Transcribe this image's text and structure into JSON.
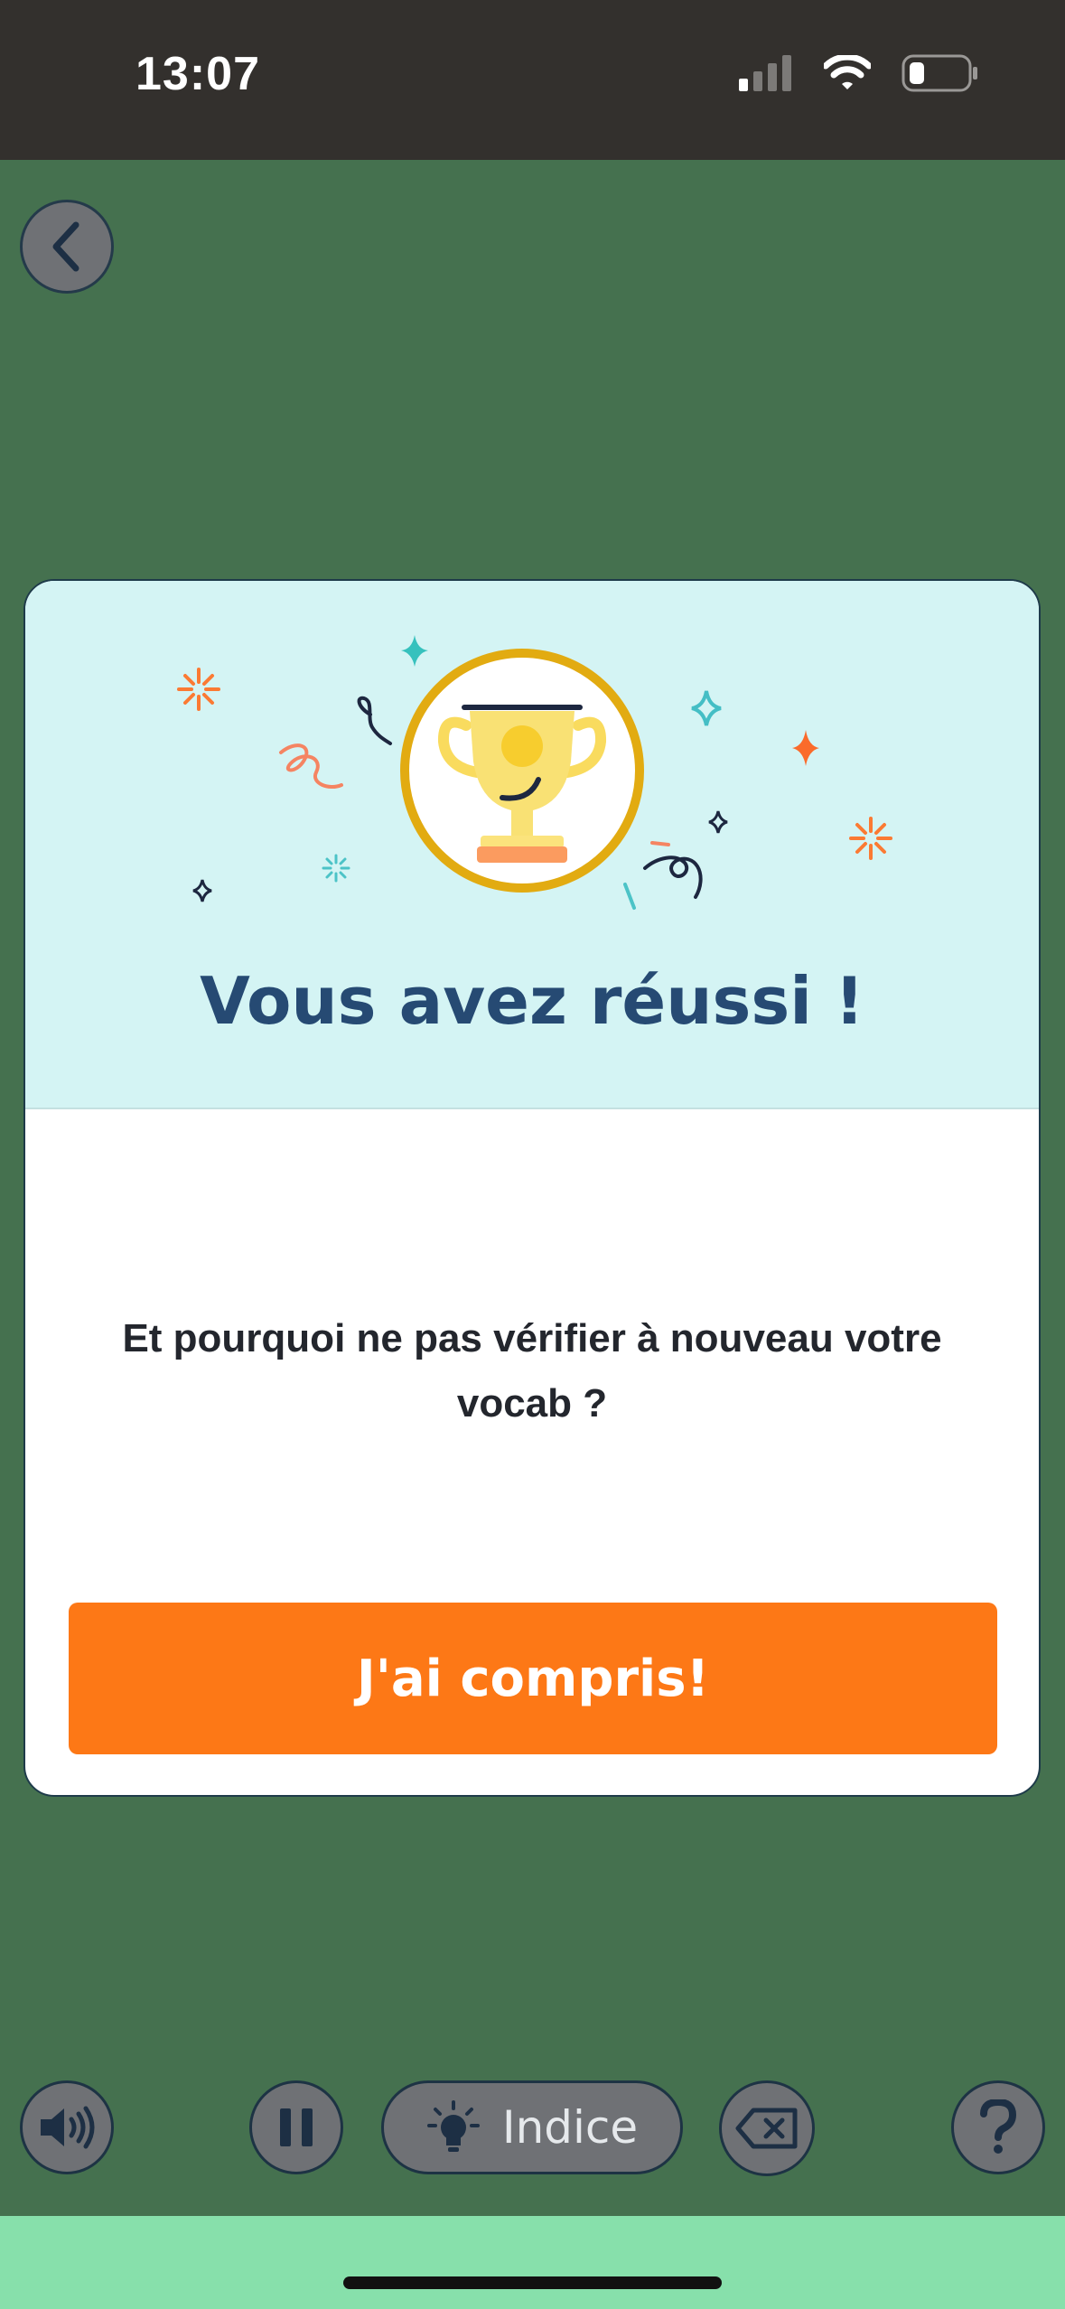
{
  "status_bar": {
    "time": "13:07"
  },
  "modal": {
    "title": "Vous avez réussi !",
    "message": "Et pourquoi ne pas vérifier à nouveau votre vocab ?",
    "cta_label": "J'ai compris!"
  },
  "bottom_bar": {
    "hint_label": "Indice"
  },
  "colors": {
    "background": "#45714f",
    "modal_header": "#d4f4f4",
    "title": "#264a73",
    "cta": "#fd7816",
    "home_area": "#87e0ab"
  }
}
